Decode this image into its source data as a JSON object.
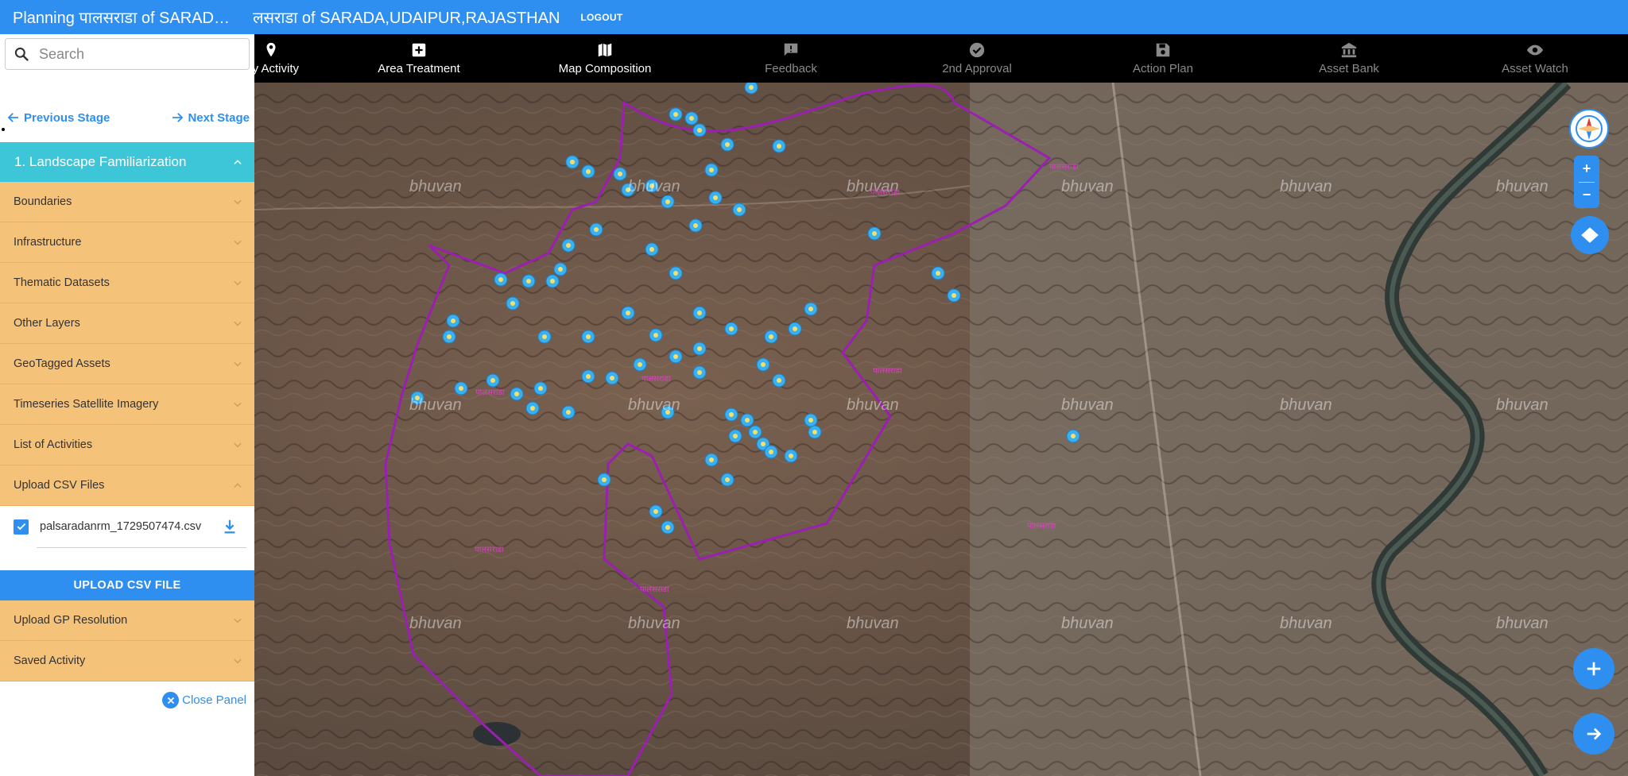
{
  "header": {
    "title_a": "Planning पालसराडा of SARADA,UDAIPUR,RAJASTHAN",
    "title_b": "लसराडा of SARADA,UDAIPUR,RAJASTHAN",
    "logout": "LOGOUT"
  },
  "sidebar": {
    "search_placeholder": "Search",
    "prev_stage": "Previous Stage",
    "next_stage": "Next Stage",
    "section_title": "1. Landscape Familiarization",
    "items": [
      {
        "label": "Boundaries"
      },
      {
        "label": "Infrastructure"
      },
      {
        "label": "Thematic Datasets"
      },
      {
        "label": "Other Layers"
      },
      {
        "label": "GeoTagged Assets"
      },
      {
        "label": "Timeseries Satellite Imagery"
      },
      {
        "label": "List of Activities"
      },
      {
        "label": "Upload CSV Files"
      }
    ],
    "csv_file": "palsaradanrm_1729507474.csv",
    "upload_button": "UPLOAD CSV FILE",
    "items_after": [
      {
        "label": "Upload GP Resolution"
      },
      {
        "label": "Saved Activity"
      }
    ],
    "close_panel": "Close Panel"
  },
  "toolbar": {
    "tools": [
      {
        "label": "tify Activity",
        "icon": "map-pin-icon"
      },
      {
        "label": "Area Treatment",
        "icon": "plus-box-icon"
      },
      {
        "label": "Map Composition",
        "icon": "map-icon"
      },
      {
        "label": "Feedback",
        "icon": "feedback-icon"
      },
      {
        "label": "2nd Approval",
        "icon": "check-circle-icon"
      },
      {
        "label": "Action Plan",
        "icon": "save-icon"
      },
      {
        "label": "Asset Bank",
        "icon": "bank-icon"
      },
      {
        "label": "Asset Watch",
        "icon": "eye-icon"
      }
    ]
  },
  "map": {
    "watermark": "bhuvan",
    "village_labels": [
      "पालसराडा",
      "पालसराडा",
      "पालसराडा",
      "पालसराडा",
      "पालसराडा",
      "पालसराडा",
      "पालसराडा",
      "पालसराडा"
    ],
    "zoom_in": "+",
    "zoom_out": "−"
  },
  "colors": {
    "accent": "#2f8ff0",
    "section": "#3cc6d8",
    "accordion": "#f5c27a",
    "boundary": "#9b1fb0",
    "marker": "#3ab0f0"
  }
}
